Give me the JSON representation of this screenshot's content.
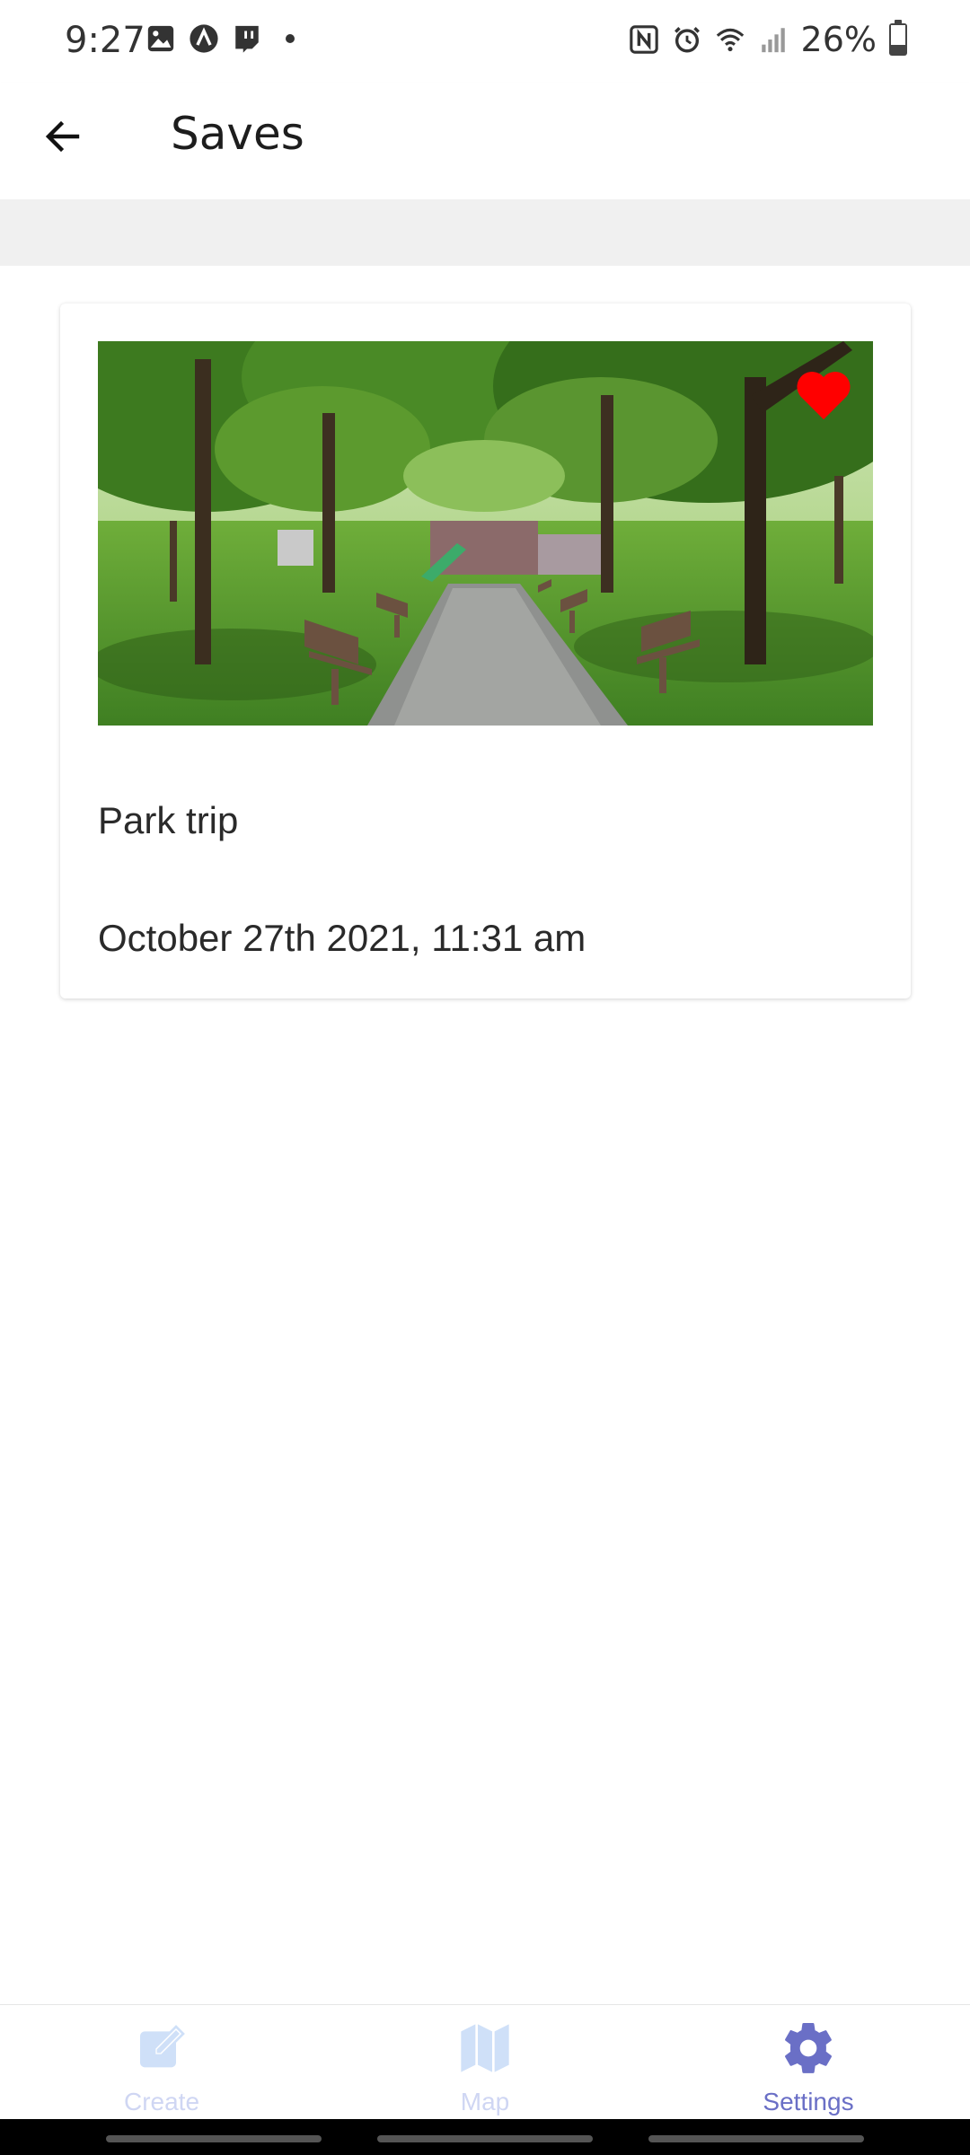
{
  "status_bar": {
    "time": "9:27",
    "battery_percent": "26%",
    "left_icons": [
      "gallery-icon",
      "app-a-icon",
      "twitch-icon",
      "dot-icon"
    ],
    "right_icons": [
      "nfc-icon",
      "alarm-icon",
      "wifi-icon",
      "signal-icon",
      "battery-icon"
    ]
  },
  "header": {
    "title": "Saves",
    "back_icon": "arrow-left-icon"
  },
  "card": {
    "title": "Park trip",
    "date": "October 27th 2021, 11:31 am",
    "favorited": true,
    "heart_color": "#ff0000"
  },
  "bottom_nav": {
    "items": [
      {
        "label": "Create",
        "icon": "pencil-icon",
        "active": false
      },
      {
        "label": "Map",
        "icon": "map-icon",
        "active": false
      },
      {
        "label": "Settings",
        "icon": "gear-icon",
        "active": true
      }
    ],
    "active_color": "#6a6fc6",
    "inactive_color": "#cfd6f3"
  }
}
